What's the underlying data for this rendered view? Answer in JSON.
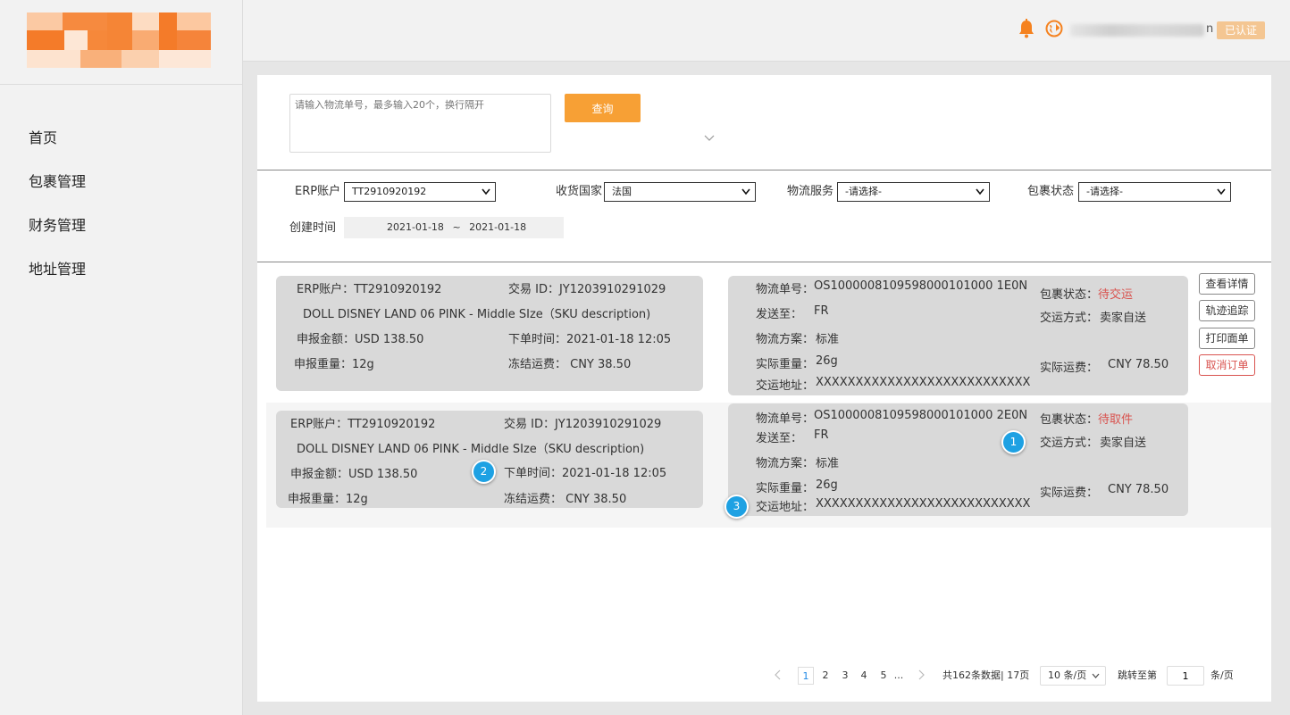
{
  "header": {
    "username_tail": "n",
    "verified_badge": "已认证",
    "bell_icon": "bell-icon",
    "globe_icon": "globe-icon",
    "accent_color": "#f5821f"
  },
  "sidebar": {
    "items": [
      {
        "label": "首页"
      },
      {
        "label": "包裹管理"
      },
      {
        "label": "财务管理"
      },
      {
        "label": "地址管理"
      }
    ]
  },
  "search": {
    "placeholder": "请输入物流单号，最多输入20个，换行隔开",
    "button_label": "查询"
  },
  "filters": {
    "erp_label": "ERP账户",
    "erp_value": "TT2910920192",
    "country_label": "收货国家",
    "country_value": "法国",
    "service_label": "物流服务",
    "service_value": "-请选择-",
    "status_label": "包裹状态",
    "status_value": "-请选择-",
    "created_label": "创建时间",
    "date_from": "2021-01-18",
    "date_sep": "~",
    "date_to": "2021-01-18"
  },
  "orders": [
    {
      "erp": "ERP账户：TT2910920192",
      "txn": "交易 ID：JY1203910291029",
      "product": "DOLL DISNEY LAND 06 PINK - Middle SIze（SKU description)",
      "amount": "申报金额：USD 138.50",
      "order_time": "下单时间：2021-01-18 12:05",
      "weight": "申报重量：12g",
      "frozen_fee": "冻结运费：  CNY 38.50",
      "tracking_label": "物流单号：",
      "tracking_no": "OS1000008109598000101000 1E0N",
      "send_to_label": "发送至：",
      "send_to": "FR",
      "plan_label": "物流方案：",
      "plan": "标准",
      "actual_weight_label": "实际重量：",
      "actual_weight": "26g",
      "address_label": "交运地址：",
      "address": "XXXXXXXXXXXXXXXXXXXXXXXXXXX",
      "status_label": "包裹状态：",
      "status": "待交运",
      "ship_method_label": "交运方式：",
      "ship_method": "卖家自送",
      "actual_fee_label": "实际运费：",
      "actual_fee": "CNY 78.50"
    },
    {
      "erp": "ERP账户：TT2910920192",
      "txn": "交易 ID：JY1203910291029",
      "product": "DOLL DISNEY LAND 06 PINK - Middle SIze（SKU description)",
      "amount": "申报金额：USD 138.50",
      "order_time": "下单时间：2021-01-18 12:05",
      "weight": "申报重量：12g",
      "frozen_fee": "冻结运费：  CNY 38.50",
      "tracking_label": "物流单号：",
      "tracking_no": "OS1000008109598000101000 2E0N",
      "send_to_label": "发送至：",
      "send_to": "FR",
      "plan_label": "物流方案：",
      "plan": "标准",
      "actual_weight_label": "实际重量：",
      "actual_weight": "26g",
      "address_label": "交运地址：",
      "address": "XXXXXXXXXXXXXXXXXXXXXXXXXXX",
      "status_label": "包裹状态：",
      "status": "待取件",
      "ship_method_label": "交运方式：",
      "ship_method": "卖家自送",
      "actual_fee_label": "实际运费：",
      "actual_fee": "CNY 78.50"
    }
  ],
  "actions": {
    "view_detail": "查看详情",
    "track": "轨迹追踪",
    "print_label": "打印面单",
    "cancel_order": "取消订单"
  },
  "markers": [
    "1",
    "2",
    "3"
  ],
  "pagination": {
    "pages": [
      "1",
      "2",
      "3",
      "4",
      "5"
    ],
    "ellipsis": "...",
    "current": "1",
    "total_text": "共162条数据| 17页",
    "page_size": "10 条/页",
    "jump_label": "跳转至第",
    "jump_value": "1",
    "jump_suffix": "条/页"
  }
}
